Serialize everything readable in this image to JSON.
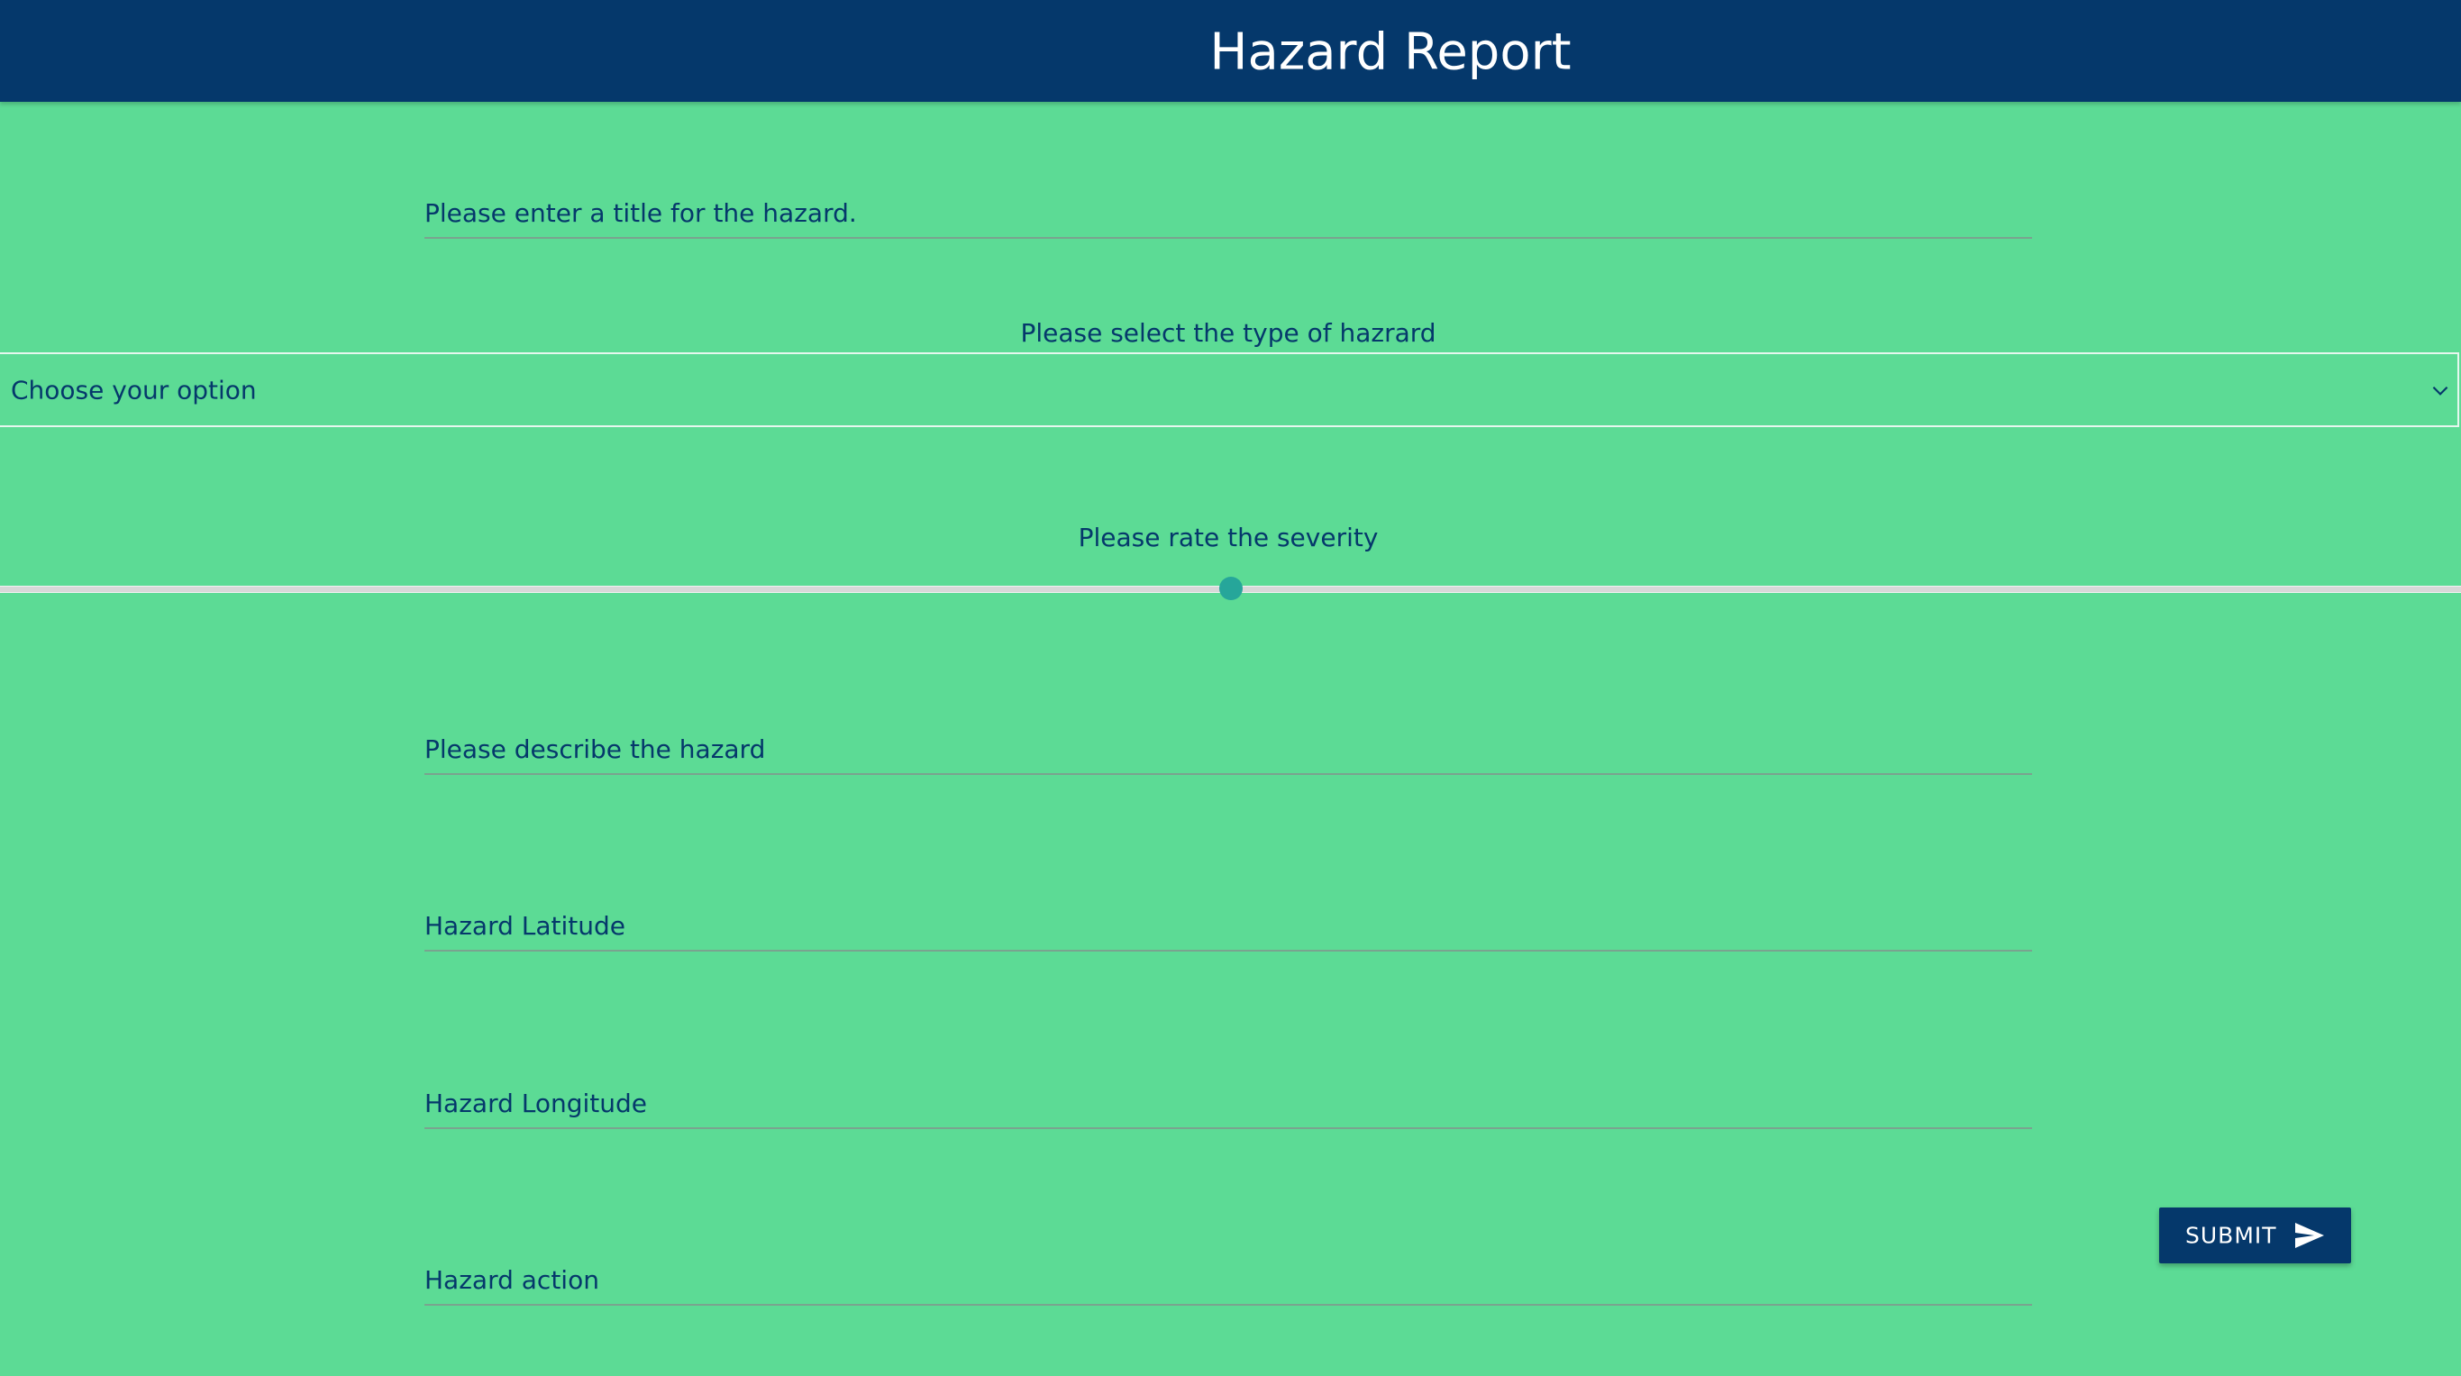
{
  "header": {
    "title": "Hazard Report",
    "background_color": "#05386b"
  },
  "form": {
    "background_color": "#5cdb95",
    "title_field": {
      "placeholder": "Please enter a title for the hazard.",
      "value": ""
    },
    "hazard_type": {
      "label": "Please select the type of hazrard",
      "selected": "Choose your option",
      "icon": "chevron-down-icon"
    },
    "severity": {
      "label": "Please rate the severity",
      "value_fraction": 0.5,
      "thumb_color": "#26a69a"
    },
    "description_field": {
      "placeholder": "Please describe the hazard",
      "value": ""
    },
    "latitude_field": {
      "placeholder": "Hazard Latitude",
      "value": ""
    },
    "longitude_field": {
      "placeholder": "Hazard Longitude",
      "value": ""
    },
    "action_field": {
      "placeholder": "Hazard action",
      "value": ""
    },
    "submit": {
      "label": "SUBMIT",
      "icon": "send-icon"
    }
  }
}
